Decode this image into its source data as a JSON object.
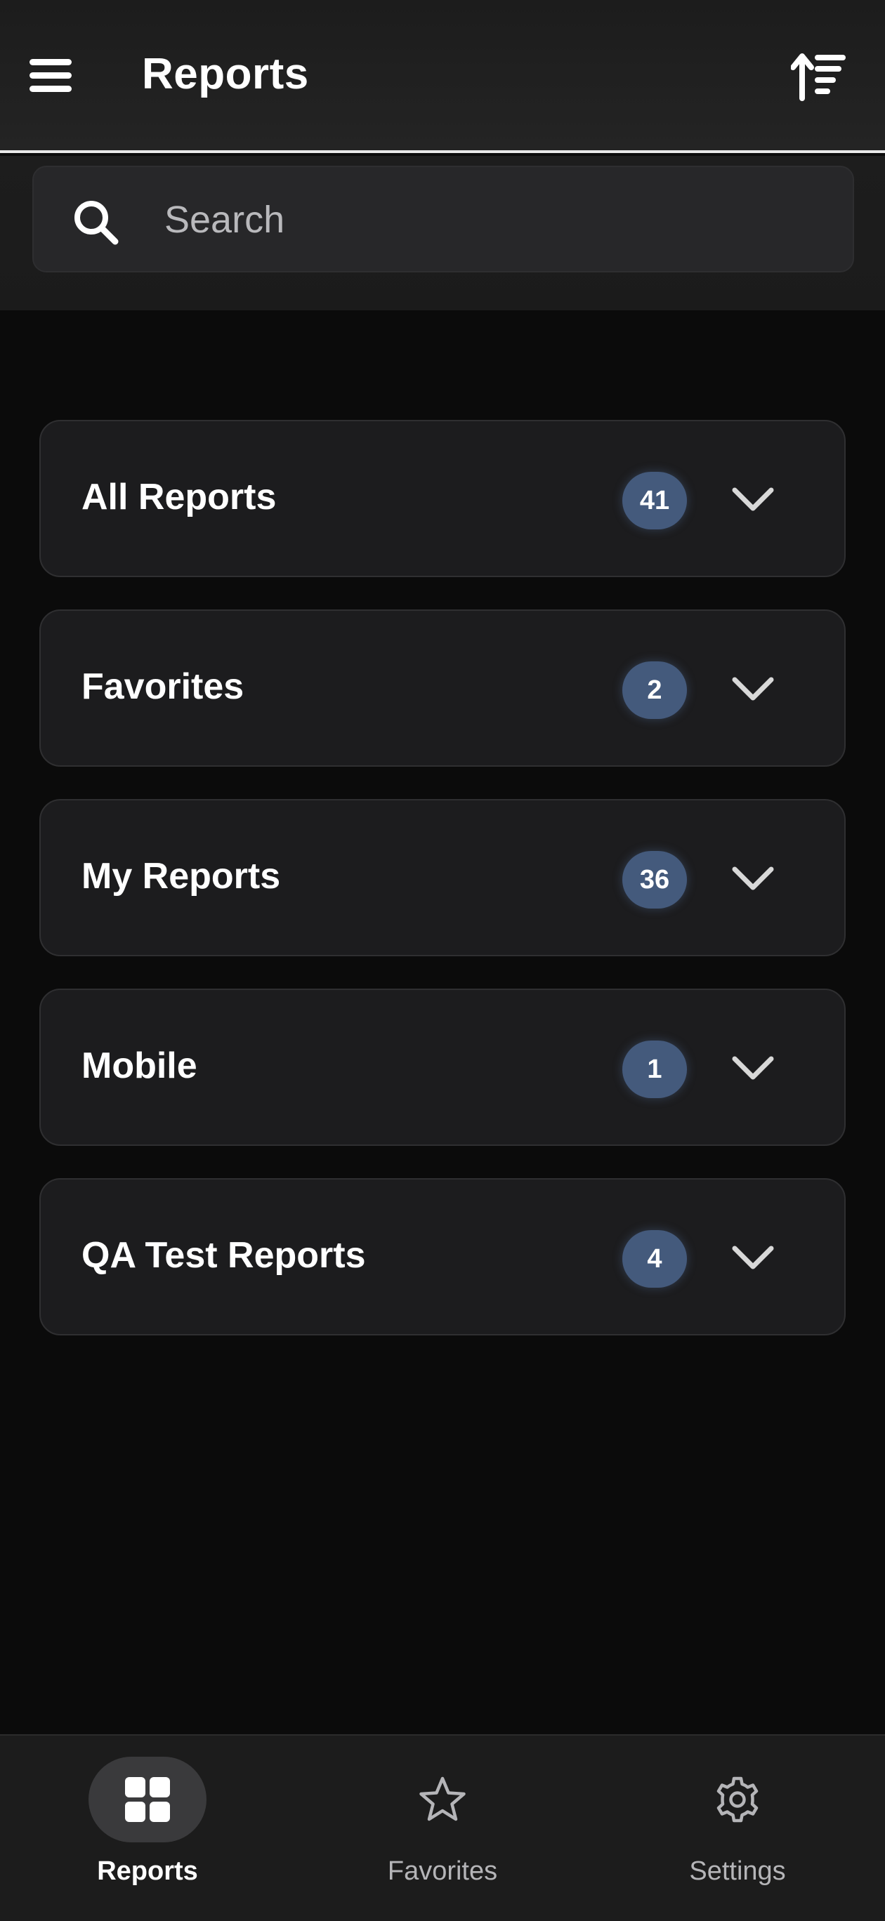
{
  "header": {
    "title": "Reports",
    "menu_icon": "hamburger-menu-icon",
    "sort_icon": "sort-ascending-icon"
  },
  "search": {
    "placeholder": "Search",
    "value": "",
    "icon": "search-icon"
  },
  "groups": [
    {
      "label": "All Reports",
      "count": "41"
    },
    {
      "label": "Favorites",
      "count": "2"
    },
    {
      "label": "My Reports",
      "count": "36"
    },
    {
      "label": "Mobile",
      "count": "1"
    },
    {
      "label": "QA Test Reports",
      "count": "4"
    }
  ],
  "bottom_nav": {
    "items": [
      {
        "label": "Reports",
        "icon": "grid-icon",
        "active": true
      },
      {
        "label": "Favorites",
        "icon": "star-icon",
        "active": false
      },
      {
        "label": "Settings",
        "icon": "gear-icon",
        "active": false
      }
    ]
  },
  "colors": {
    "background": "#0b0b0b",
    "card": "#1c1c1e",
    "badge": "#445a7c",
    "header_divider": "#e8e8e8"
  }
}
